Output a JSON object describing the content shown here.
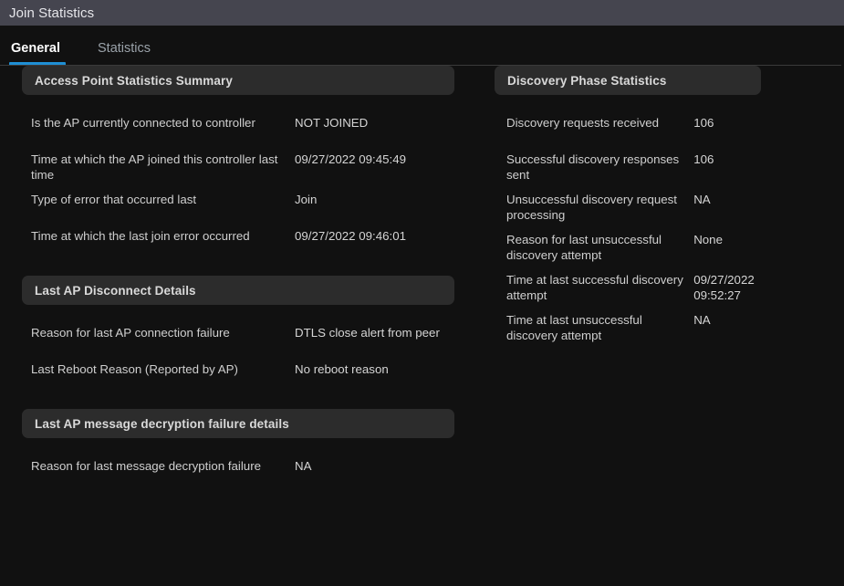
{
  "window": {
    "title": "Join Statistics"
  },
  "tabs": [
    {
      "label": "General",
      "active": true
    },
    {
      "label": "Statistics",
      "active": false
    }
  ],
  "colors": {
    "titlebar_bg": "#45454f",
    "page_bg": "#111111",
    "panel_header_bg": "#2c2c2c",
    "accent": "#1f8fd4",
    "active_tab_text": "#ffffff",
    "inactive_tab_text": "#9aa2a9"
  },
  "left_column": [
    {
      "title": "Access Point Statistics Summary",
      "rows": [
        {
          "label": "Is the AP currently connected to controller",
          "value": "NOT JOINED"
        },
        {
          "label": "Time at which the AP joined this controller last time",
          "value": "09/27/2022 09:45:49"
        },
        {
          "label": "Type of error that occurred last",
          "value": "Join"
        },
        {
          "label": "Time at which the last join error occurred",
          "value": "09/27/2022 09:46:01"
        }
      ]
    },
    {
      "title": "Last AP Disconnect Details",
      "rows": [
        {
          "label": "Reason for last AP connection failure",
          "value": "DTLS close alert from peer"
        },
        {
          "label": "Last Reboot Reason (Reported by AP)",
          "value": "No reboot reason"
        }
      ]
    },
    {
      "title": "Last AP message decryption failure details",
      "rows": [
        {
          "label": "Reason for last message decryption failure",
          "value": "NA"
        }
      ]
    }
  ],
  "right_column": [
    {
      "title": "Discovery Phase Statistics",
      "rows": [
        {
          "label": "Discovery requests received",
          "value": "106"
        },
        {
          "label": "Successful discovery responses sent",
          "value": "106"
        },
        {
          "label": "Unsuccessful discovery request processing",
          "value": "NA"
        },
        {
          "label": "Reason for last unsuccessful discovery attempt",
          "value": "None"
        },
        {
          "label": "Time at last successful discovery attempt",
          "value": "09/27/2022 09:52:27"
        },
        {
          "label": "Time at last unsuccessful discovery attempt",
          "value": "NA"
        }
      ]
    }
  ]
}
